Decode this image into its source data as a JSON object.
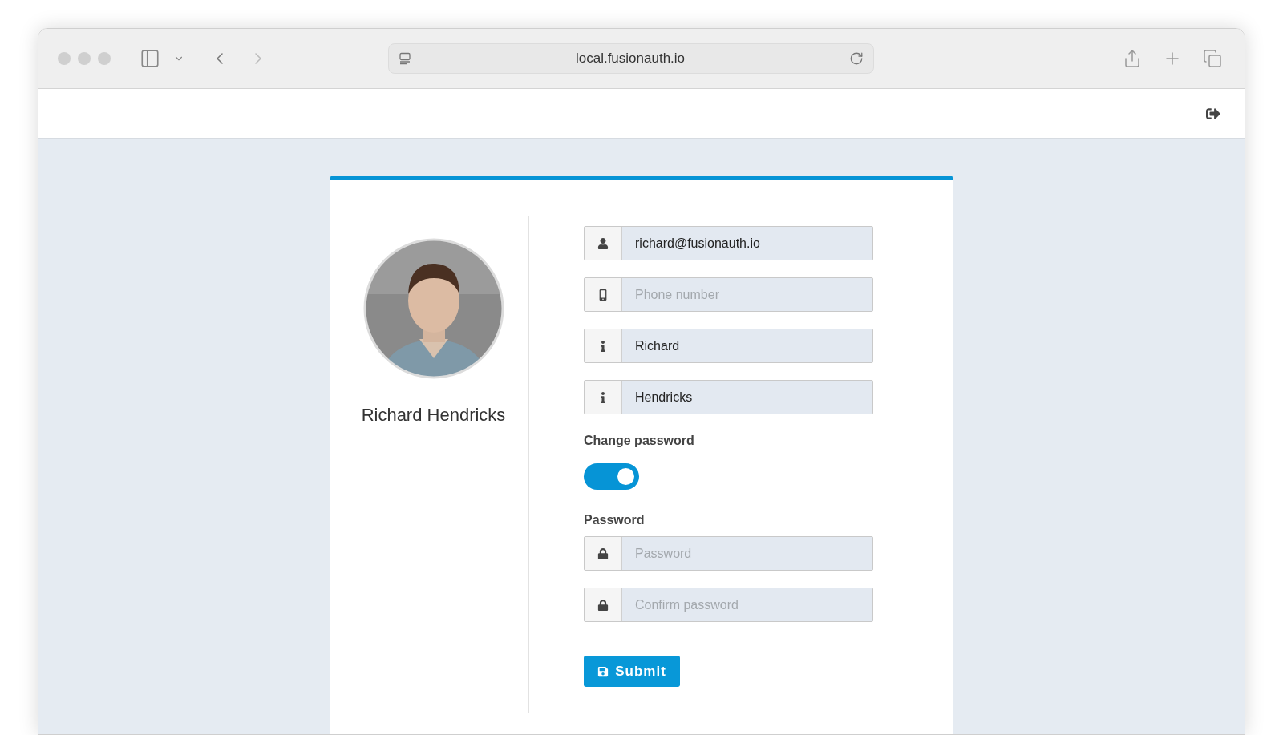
{
  "browser": {
    "address": "local.fusionauth.io"
  },
  "profile": {
    "name": "Richard Hendricks"
  },
  "fields": [
    {
      "kind": "email",
      "value": "richard@fusionauth.io"
    },
    {
      "kind": "phone",
      "placeholder": "Phone number"
    },
    {
      "kind": "name",
      "value": "Richard"
    },
    {
      "kind": "name",
      "value": "Hendricks"
    }
  ],
  "change_password": {
    "label": "Change password",
    "on": true
  },
  "password_section": {
    "label": "Password",
    "fields": [
      {
        "kind": "password",
        "placeholder": "Password"
      },
      {
        "kind": "password",
        "placeholder": "Confirm password"
      }
    ]
  },
  "submit": {
    "label": "Submit"
  }
}
